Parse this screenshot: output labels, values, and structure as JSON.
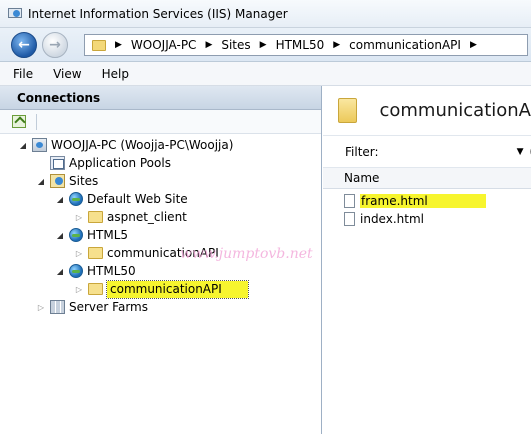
{
  "window": {
    "title": "Internet Information Services (IIS) Manager"
  },
  "address": {
    "breadcrumbs": [
      "WOOJJA-PC",
      "Sites",
      "HTML50",
      "communicationAPI"
    ]
  },
  "menu": {
    "items": [
      "File",
      "View",
      "Help"
    ]
  },
  "connections": {
    "title": "Connections",
    "tree": {
      "server": "WOOJJA-PC (Woojja-PC\\Woojja)",
      "app_pools": "Application Pools",
      "sites": "Sites",
      "default_site": "Default Web Site",
      "aspnet_client": "aspnet_client",
      "html5": "HTML5",
      "html5_comm": "communicationAPI",
      "html50": "HTML50",
      "html50_comm": "communicationAPI",
      "server_farms": "Server Farms"
    }
  },
  "watermark": "www.jumptovb.net",
  "content": {
    "title": "communicationA",
    "filter_label": "Filter:",
    "filter_go": "G",
    "column_name": "Name",
    "files": [
      "frame.html",
      "index.html"
    ]
  },
  "colors": {
    "highlight": "#f7f52e",
    "accent": "#1f5aa6"
  }
}
